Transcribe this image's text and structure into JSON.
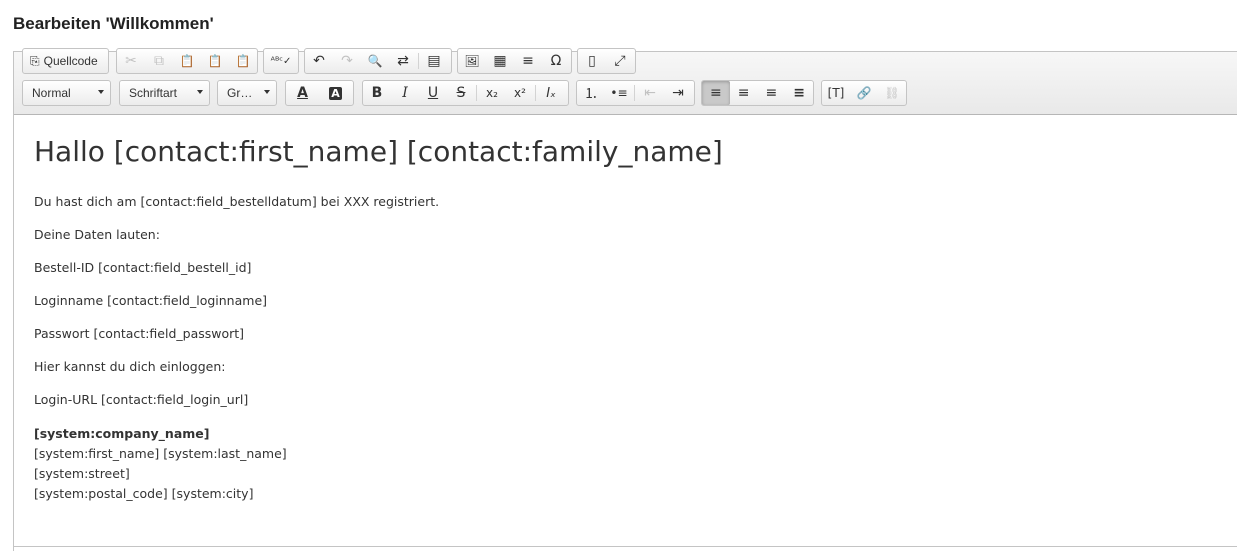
{
  "page": {
    "title": "Bearbeiten 'Willkommen'"
  },
  "toolbar": {
    "source_label": "Quellcode",
    "format_combo": "Normal",
    "font_combo": "Schriftart",
    "size_combo": "Gr…",
    "glyphs": {
      "cut": "✂",
      "copy": "⧉",
      "paste": "📋",
      "paste_text": "📋",
      "paste_word": "📋",
      "spellcheck": "ᴬᴮᶜ✓",
      "undo": "↶",
      "redo": "↷",
      "find": "🔍",
      "replace": "⇄",
      "select_all": "▤",
      "image": "🖼",
      "table": "▦",
      "hline": "≡",
      "special_char": "Ω",
      "show_blocks": "▯",
      "maximize": "⤢",
      "text_color": "A",
      "bg_color": "A",
      "bold": "B",
      "italic": "I",
      "underline": "U",
      "strike": "S",
      "subscript": "x₂",
      "superscript": "x²",
      "remove_format": "Iₓ",
      "numbered_list": "⒈",
      "bullet_list": "•≡",
      "outdent": "⇤",
      "indent": "⇥",
      "align_left": "≡",
      "align_center": "≡",
      "align_right": "≡",
      "justify": "≡",
      "token": "[T]",
      "link": "🔗",
      "unlink": "⛓"
    }
  },
  "content": {
    "heading": "Hallo [contact:first_name] [contact:family_name]",
    "paragraphs": [
      "Du hast dich am [contact:field_bestelldatum] bei XXX registriert.",
      "Deine Daten lauten:",
      "Bestell-ID [contact:field_bestell_id]",
      "Loginname [contact:field_loginname]",
      "Passwort [contact:field_passwort]",
      "Hier kannst du dich einloggen:",
      "Login-URL [contact:field_login_url]"
    ],
    "signature": {
      "company": "[system:company_name]",
      "name": "[system:first_name] [system:last_name]",
      "street": "[system:street]",
      "city": "[system:postal_code] [system:city]"
    }
  }
}
